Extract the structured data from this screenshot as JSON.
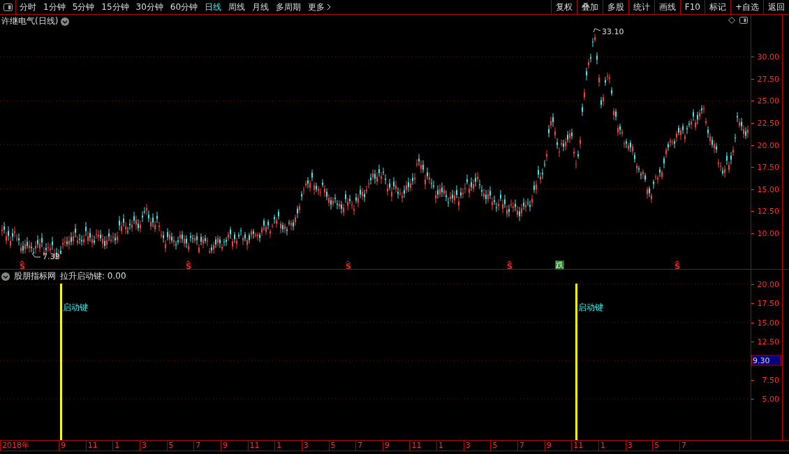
{
  "toolbar": {
    "tabs": [
      {
        "label": "分时",
        "selected": false
      },
      {
        "label": "1分钟",
        "selected": false
      },
      {
        "label": "5分钟",
        "selected": false
      },
      {
        "label": "15分钟",
        "selected": false
      },
      {
        "label": "30分钟",
        "selected": false
      },
      {
        "label": "60分钟",
        "selected": false
      },
      {
        "label": "日线",
        "selected": true
      },
      {
        "label": "周线",
        "selected": false
      },
      {
        "label": "月线",
        "selected": false
      },
      {
        "label": "多周期",
        "selected": false
      }
    ],
    "more": "更多",
    "buttons": [
      "复权",
      "叠加",
      "多股",
      "统计",
      "画线",
      "F10",
      "标记",
      "+自选",
      "返回"
    ]
  },
  "price_pane": {
    "title": "许继电气(日线)",
    "high_label": "33.10",
    "low_label": "7.32",
    "yticks": [
      "30.00",
      "27.50",
      "25.00",
      "22.50",
      "20.00",
      "17.50",
      "15.00",
      "12.50",
      "10.00"
    ],
    "signals": [
      {
        "kind": "sell",
        "label": "S"
      },
      {
        "kind": "sell",
        "label": "S"
      },
      {
        "kind": "sell",
        "label": "S"
      },
      {
        "kind": "sell",
        "label": "S"
      },
      {
        "kind": "fall",
        "label": "跌"
      },
      {
        "kind": "sell",
        "label": "S"
      }
    ]
  },
  "indicator_pane": {
    "name": "股朋指标网",
    "reading": "拉升启动键: 0.00",
    "yticks": [
      "20.00",
      "17.50",
      "15.00",
      "12.50",
      "7.50",
      "5.00"
    ],
    "current_value": "9.30",
    "markers": [
      {
        "label": "启动键"
      },
      {
        "label": "启动键"
      }
    ]
  },
  "date_axis": {
    "labels": [
      "2018年",
      "9",
      "11",
      "1",
      "3",
      "5",
      "7",
      "9",
      "11",
      "1",
      "3",
      "5",
      "7",
      "9",
      "11",
      "1",
      "3",
      "5",
      "7",
      "9",
      "11",
      "1",
      "3",
      "5",
      "7"
    ]
  }
}
